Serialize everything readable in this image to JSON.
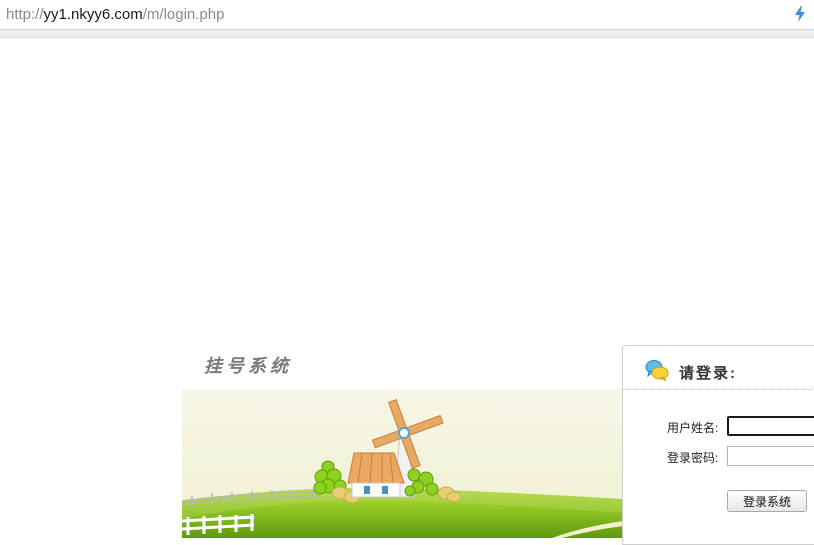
{
  "browser": {
    "url_scheme": "http://",
    "url_host": "yy1.nkyy6.com",
    "url_path": "/m/login.php",
    "bolt_icon": "lightning-icon"
  },
  "page": {
    "system_title": "挂号系统"
  },
  "login": {
    "icon": "chat-bubble-icon",
    "heading": "请登录:",
    "username_label": "用户姓名:",
    "username_value": "",
    "password_label": "登录密码:",
    "password_value": "",
    "submit_label": "登录系统"
  },
  "colors": {
    "grass": "#7cb518",
    "sky": "#f3f1dc",
    "roof": "#e9a766",
    "blade": "#e9a766"
  }
}
